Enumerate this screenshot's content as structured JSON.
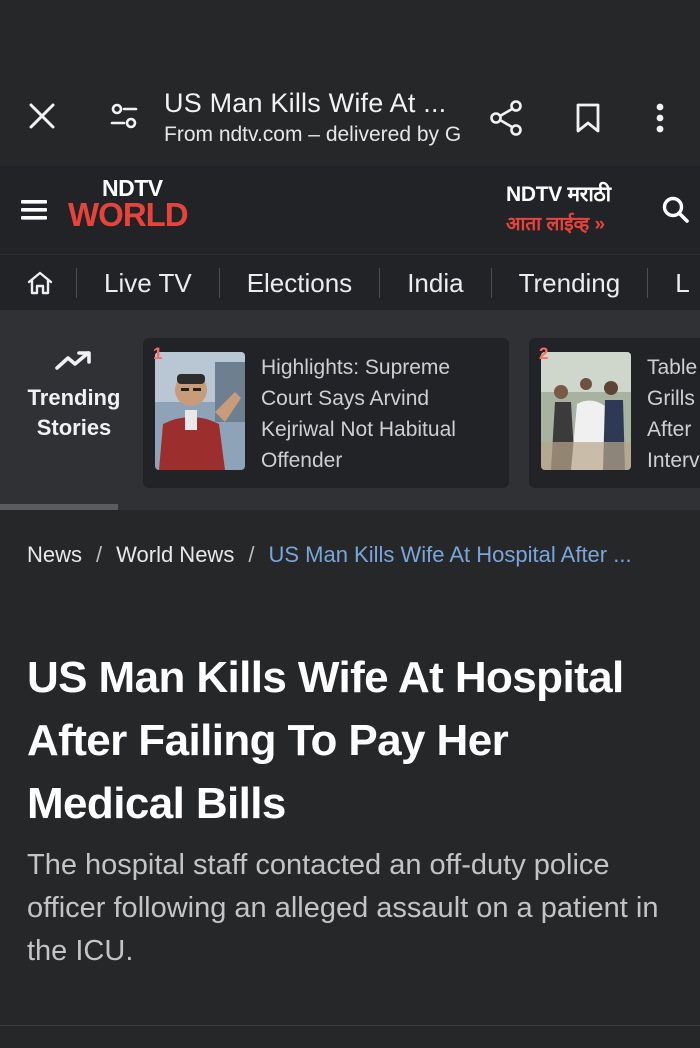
{
  "browser": {
    "title": "US Man Kills Wife At ...",
    "subtitle": "From ndtv.com – delivered by G"
  },
  "site": {
    "logo_top": "NDTV",
    "logo_bottom": "WORLD",
    "promo_title": "NDTV मराठी",
    "promo_sub": "आता लाईव्ह »",
    "accent_color": "#e8433a"
  },
  "nav": {
    "items": [
      "Live TV",
      "Elections",
      "India",
      "Trending",
      "L"
    ]
  },
  "trending": {
    "label_line1": "Trending",
    "label_line2": "Stories",
    "cards": [
      {
        "number": "1",
        "lines": [
          "Highlights: Supreme",
          "Court Says Arvind",
          "Kejriwal Not Habitual",
          "Offender"
        ]
      },
      {
        "number": "2",
        "lines": [
          "Table",
          "Grills",
          "After",
          "Interv"
        ]
      }
    ]
  },
  "breadcrumb": {
    "items": [
      "News",
      "World News"
    ],
    "separator": "/",
    "current": "US Man Kills Wife At Hospital After ..."
  },
  "article": {
    "headline_lines": [
      "US Man Kills Wife At Hospital",
      "After Failing To Pay Her",
      "Medical Bills"
    ],
    "summary": "The hospital staff contacted an off-duty police officer following an alleged assault on a patient in the ICU."
  }
}
